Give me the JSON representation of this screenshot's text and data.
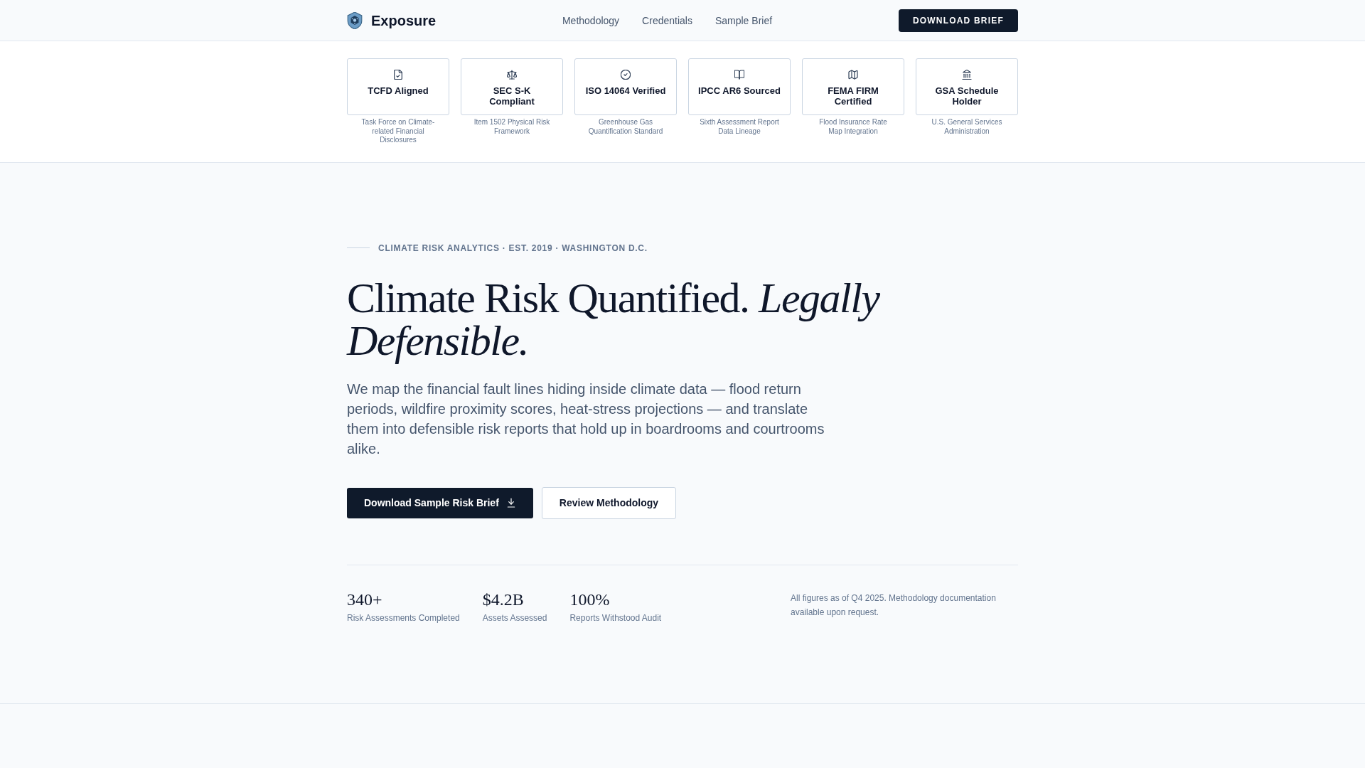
{
  "nav": {
    "brand": "Exposure",
    "links": [
      {
        "label": "Methodology"
      },
      {
        "label": "Credentials"
      },
      {
        "label": "Sample Brief"
      }
    ],
    "cta": "DOWNLOAD BRIEF"
  },
  "credentials": [
    {
      "title": "TCFD Aligned",
      "description": "Task Force on Climate-related Financial Disclosures"
    },
    {
      "title": "SEC S-K Compliant",
      "description": "Item 1502 Physical Risk Framework"
    },
    {
      "title": "ISO 14064 Verified",
      "description": "Greenhouse Gas Quantification Standard"
    },
    {
      "title": "IPCC AR6 Sourced",
      "description": "Sixth Assessment Report Data Lineage"
    },
    {
      "title": "FEMA FIRM Certified",
      "description": "Flood Insurance Rate Map Integration"
    },
    {
      "title": "GSA Schedule Holder",
      "description": "U.S. General Services Administration"
    }
  ],
  "hero": {
    "eyebrow": "CLIMATE RISK ANALYTICS · EST. 2019 · WASHINGTON D.C.",
    "heading": "Climate Risk Quantified. *Legally Defensible.*",
    "body": "We map the financial fault lines hiding inside climate data — flood return periods, wildfire proximity scores, heat-stress projections — and translate them into defensible risk reports that hold up in boardrooms and courtrooms alike.",
    "buttons": [
      {
        "label": "Download Sample Risk Brief",
        "kind": "primary"
      },
      {
        "label": "Review Methodology",
        "kind": "secondary"
      }
    ]
  },
  "stats": [
    {
      "value": "340+",
      "label": "Risk Assessments Completed"
    },
    {
      "value": "$4.2B",
      "label": "Assets Assessed"
    },
    {
      "value": "100%",
      "label": "Reports Withstood Audit"
    }
  ],
  "stats_note": "All figures as of Q4 2025. Methodology documentation available upon request."
}
